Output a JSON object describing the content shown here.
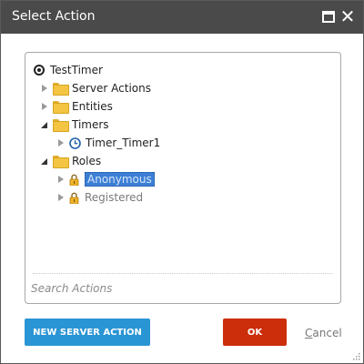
{
  "dialog": {
    "title": "Select Action"
  },
  "tree": {
    "root": "TestTimer",
    "items": [
      {
        "label": "Server Actions"
      },
      {
        "label": "Entities"
      },
      {
        "label": "Timers"
      },
      {
        "label": "Timer_Timer1"
      },
      {
        "label": "Roles"
      },
      {
        "label": "Anonymous"
      },
      {
        "label": "Registered"
      }
    ]
  },
  "search": {
    "placeholder": "Search Actions"
  },
  "buttons": {
    "new_server_action": "NEW SERVER ACTION",
    "ok": "OK",
    "cancel_first": "C",
    "cancel_rest": "ancel"
  },
  "colors": {
    "titlebar": "#4a4a4a",
    "primary": "#2a95d4",
    "ok": "#cc2d0a",
    "selection": "#3c7fd6",
    "folder": "#f4c542"
  },
  "icons": {
    "root": "radio-icon",
    "folder": "folder-icon",
    "timer": "clock-icon",
    "role": "lock-icon"
  }
}
